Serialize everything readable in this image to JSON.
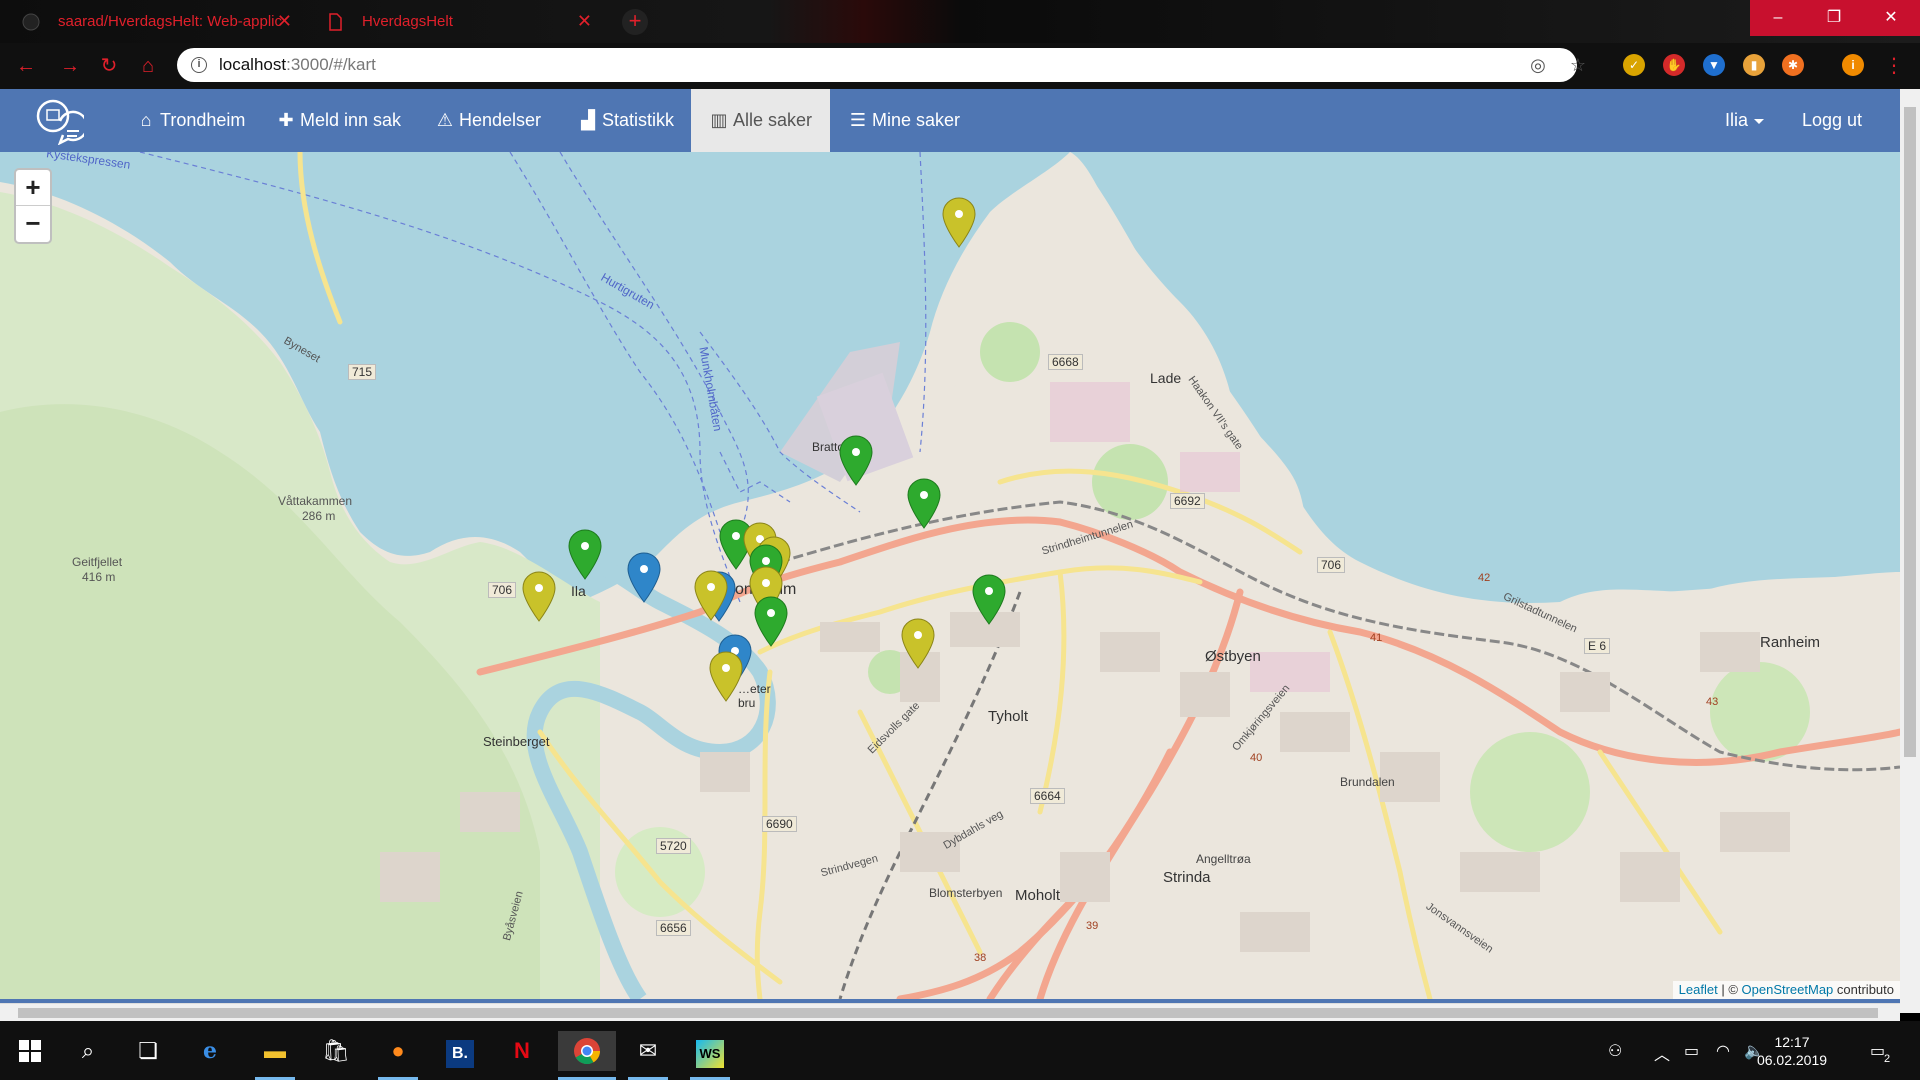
{
  "browser": {
    "tabs": [
      {
        "title": "saarad/HverdagsHelt: Web-applic",
        "icon": "github-icon"
      },
      {
        "title": "HverdagsHelt",
        "icon": "page-icon"
      }
    ],
    "new_tab": "+",
    "url_host": "localhost",
    "url_path": ":3000/#/kart",
    "window_controls": {
      "minimize": "–",
      "maximize": "❐",
      "close": "✕"
    },
    "extensions": [
      "norton-icon",
      "adblock-icon",
      "vpn-shield-icon",
      "bottle-icon",
      "avast-icon",
      "profile-icon"
    ],
    "profile_initial": "i"
  },
  "navbar": {
    "items": [
      {
        "label": "Trondheim",
        "icon": "home-icon"
      },
      {
        "label": "Meld inn sak",
        "icon": "plus-icon"
      },
      {
        "label": "Hendelser",
        "icon": "warning-icon"
      },
      {
        "label": "Statistikk",
        "icon": "bar-chart-icon"
      },
      {
        "label": "Alle saker",
        "icon": "map-icon"
      },
      {
        "label": "Mine saker",
        "icon": "table-icon"
      }
    ],
    "active": "Alle saker",
    "user": "Ilia",
    "logout": "Logg ut"
  },
  "map": {
    "zoom_in": "+",
    "zoom_out": "−",
    "labels": {
      "place_lade": "Lade",
      "place_ila": "Ila",
      "place_trondheim": "ondheim",
      "place_ostbyen": "Østbyen",
      "place_tyholt": "Tyholt",
      "place_moholt": "Moholt",
      "place_strinda": "Strinda",
      "place_ranheim": "Ranheim",
      "place_steinberget": "Steinberget",
      "place_vattakammen": "Våttakammen",
      "place_vattakammen_h": "286 m",
      "place_geitfjellet": "Geitfjellet",
      "place_geitfjellet_h": "416 m",
      "place_brattora": "Bratto",
      "place_brundalen": "Brundalen",
      "place_bakklandet": "…eter bru",
      "place_angelltroa": "Angelltrøa",
      "place_blomsterbyen": "Blomsterbyen",
      "water_hurtigruten": "Hurtigruten",
      "water_kystekspressen": "Kystekspressen",
      "water_munkholm": "Munkholmbåten",
      "road_715": "715",
      "road_706a": "706",
      "road_706b": "706",
      "road_6668": "6668",
      "road_6692": "6692",
      "road_6664": "6664",
      "road_6690": "6690",
      "road_5720": "5720",
      "road_6656": "6656",
      "road_e6": "E 6",
      "road_42": "42",
      "road_43": "43",
      "road_41": "41",
      "road_40": "40",
      "road_39": "39",
      "road_38": "38",
      "street_stridsheim": "Strindheimtunnelen",
      "street_haakon": "Haakon VII's gate",
      "street_omkjoring": "Omkjøringsveien",
      "street_byasveien": "Byåsveien",
      "street_jonsvann": "Jonsvannsveien",
      "street_grilstad": "Grilstadtunnelen",
      "street_eidsvolls": "Eidsvolls gate",
      "street_dybdahls": "Dybdahls veg",
      "street_byneset": "Byneset",
      "street_strind": "Strindvegen"
    },
    "pin_colors": {
      "green": "#2eaa2e",
      "yellow": "#c9c22a",
      "blue": "#2f86c9"
    },
    "attribution_leaflet": "Leaflet",
    "attribution_sep": " | © ",
    "attribution_osm": "OpenStreetMap",
    "attribution_rest": " contributo"
  },
  "taskbar": {
    "time": "12:17",
    "date": "06.02.2019",
    "notifications": "2",
    "apps": [
      "start-icon",
      "search-icon",
      "task-view-icon",
      "edge-icon",
      "file-explorer-icon",
      "store-icon",
      "firefox-icon",
      "booking-icon",
      "netflix-icon",
      "chrome-icon",
      "mail-icon",
      "webstorm-icon"
    ]
  }
}
